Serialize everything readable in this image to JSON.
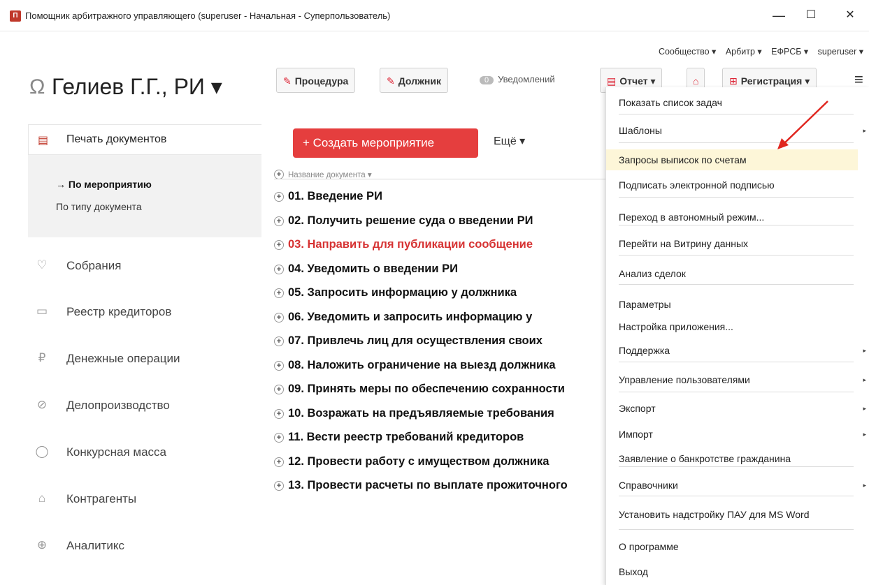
{
  "window": {
    "icon_text": "П",
    "title": "Помощник арбитражного управляющего (superuser - Начальная - Суперпользователь)",
    "minimize": "—",
    "maximize": "☐",
    "close": "✕"
  },
  "toplinks": [
    "Сообщество ▾",
    "Арбитр ▾",
    "ЕФРСБ ▾",
    "superuser ▾"
  ],
  "header": {
    "user_icon": "Ω",
    "user_name": "Гелиев Г.Г., РИ ▾",
    "procedure_btn": "Процедура",
    "debtor_btn": "Должник",
    "notif_count": "0",
    "notif_label": "Уведомлений",
    "report_btn": "Отчет ▾",
    "registration_btn": "Регистрация ▾",
    "hamburger": "≡",
    "edit_icon": "✎",
    "doc_icon": "▤",
    "reg_icon": "⊞",
    "mid_icon": "⌂"
  },
  "sidebar": {
    "print_label": "Печать документов",
    "print_icon": "▤",
    "sub_items": [
      "→ По мероприятию",
      "По типу документа"
    ],
    "items": [
      {
        "icon": "♡",
        "label": "Собрания"
      },
      {
        "icon": "▭",
        "label": "Реестр кредиторов"
      },
      {
        "icon": "₽",
        "label": "Денежные операции"
      },
      {
        "icon": "⊘",
        "label": "Делопроизводство"
      },
      {
        "icon": "◯",
        "label": "Конкурсная масса"
      },
      {
        "icon": "⌂",
        "label": "Контрагенты"
      },
      {
        "icon": "⊕",
        "label": "Аналитикс"
      }
    ]
  },
  "main": {
    "create_btn": "+ Создать мероприятие",
    "more": "Ещё ▾",
    "col_plus": "+",
    "col_header": "Название документа ▾",
    "documents": [
      {
        "text": "01. Введение РИ",
        "red": false
      },
      {
        "text": "02. Получить решение суда о введении РИ",
        "red": false
      },
      {
        "text": "03. Направить для публикации сообщение",
        "red": true
      },
      {
        "text": "04. Уведомить о введении РИ",
        "red": false
      },
      {
        "text": "05. Запросить информацию у должника",
        "red": false
      },
      {
        "text": "06. Уведомить и запросить информацию у",
        "red": false
      },
      {
        "text": "07. Привлечь лиц для осуществления своих",
        "red": false
      },
      {
        "text": "08. Наложить ограничение на выезд должника",
        "red": false
      },
      {
        "text": "09. Принять меры по обеспечению сохранности",
        "red": false
      },
      {
        "text": "10. Возражать на предъявляемые требования",
        "red": false
      },
      {
        "text": "11. Вести реестр требований кредиторов",
        "red": false
      },
      {
        "text": "12. Провести работу с имуществом должника",
        "red": false
      },
      {
        "text": "13. Провести расчеты по выплате прожиточного",
        "red": false
      }
    ]
  },
  "menu": {
    "items": [
      {
        "label": "Показать список задач",
        "submenu": false
      },
      {
        "label": "Шаблоны",
        "submenu": true
      },
      {
        "label": "Запросы выписок по счетам",
        "submenu": false,
        "highlighted": true
      },
      {
        "label": "Подписать электронной подписью",
        "submenu": false
      },
      {
        "label": "Переход в автономный режим...",
        "submenu": false
      },
      {
        "label": "Перейти на Витрину данных",
        "submenu": false
      },
      {
        "label": "Анализ сделок",
        "submenu": false
      },
      {
        "label": "Параметры",
        "submenu": false
      },
      {
        "label": "Настройка приложения...",
        "submenu": false
      },
      {
        "label": "Поддержка",
        "submenu": true
      },
      {
        "label": "Управление пользователями",
        "submenu": true
      },
      {
        "label": "Экспорт",
        "submenu": true
      },
      {
        "label": "Импорт",
        "submenu": true
      },
      {
        "label": "Заявление о банкротстве гражданина",
        "submenu": false
      },
      {
        "label": "Справочники",
        "submenu": true
      },
      {
        "label": "Установить надстройку ПАУ для MS Word",
        "submenu": false
      },
      {
        "label": "О программе",
        "submenu": false
      },
      {
        "label": "Выход",
        "submenu": false
      }
    ],
    "submenu_arrow": "▸"
  },
  "colors": {
    "accent": "#e53e3e",
    "highlight": "#fdf6d8",
    "annotation_arrow": "#e0261f"
  }
}
